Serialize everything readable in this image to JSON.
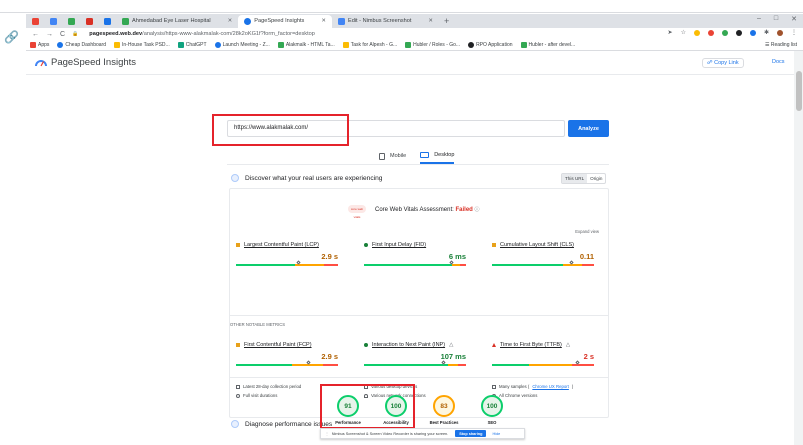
{
  "browser": {
    "tabs": [
      {
        "label": "Ahmedabad Eye Laser Hospital",
        "active": false
      },
      {
        "label": "PageSpeed Insights",
        "active": true
      },
      {
        "label": "Edit - Nimbus Screenshot",
        "active": false
      }
    ],
    "new_tab": "+",
    "window_controls": [
      "–",
      "□",
      "✕"
    ],
    "nav": {
      "back": "←",
      "forward": "→",
      "reload": "C"
    },
    "url_host": "pagespeed.web.dev",
    "url_path": "/analysis/https-www-alakmalak-com/28k2oKG1f?form_factor=desktop",
    "bookmarks": [
      {
        "label": "Apps",
        "color": "#ea4335"
      },
      {
        "label": "Cheap Dashboard",
        "color": "#1a73e8"
      },
      {
        "label": "In-House Task PSD...",
        "color": "#fbbc04"
      },
      {
        "label": "ChatGPT",
        "color": "#10a37f"
      },
      {
        "label": "Launch Meeting - Z...",
        "color": "#1a73e8"
      },
      {
        "label": "Alakmalk - HTML Ta...",
        "color": "#34a853"
      },
      {
        "label": "Task for Alpesh - G...",
        "color": "#fbbc04"
      },
      {
        "label": "Hubler / Roles - Go...",
        "color": "#34a853"
      },
      {
        "label": "RPO Application",
        "color": "#202124"
      },
      {
        "label": "Hubler - after devel...",
        "color": "#34a853"
      }
    ],
    "reading_list": "Reading list"
  },
  "psi": {
    "title": "PageSpeed Insights",
    "copy_link": "Copy Link",
    "docs": "Docs",
    "url_value": "https://www.alakmalak.com/",
    "analyze": "Analyze",
    "device_tabs": {
      "mobile": "Mobile",
      "desktop": "Desktop"
    },
    "crux_heading": "Discover what your real users are experiencing",
    "this_url": "This URL",
    "origin": "Origin",
    "cwv_logo": "core web vitals",
    "cwv_assessment_label": "Core Web Vitals Assessment:",
    "cwv_assessment_status": "Failed",
    "expand_view": "Expand view",
    "other_metrics_label": "OTHER NOTABLE METRICS",
    "metrics": [
      {
        "name": "Largest Contentful Paint (LCP)",
        "value": "2.9 s"
      },
      {
        "name": "First Input Delay (FID)",
        "value": "6 ms"
      },
      {
        "name": "Cumulative Layout Shift (CLS)",
        "value": "0.11"
      },
      {
        "name": "First Contentful Paint (FCP)",
        "value": "2.9 s"
      },
      {
        "name": "Interaction to Next Paint (INP)",
        "value": "107 ms"
      },
      {
        "name": "Time to First Byte (TTFB)",
        "value": "2 s"
      }
    ],
    "info": {
      "period": "Latest 28-day collection period",
      "visit": "Full visit durations",
      "devices": "Various desktop devices",
      "network": "Various network connections",
      "samples_prefix": "Many samples (",
      "samples_link": "Chrome UX Report",
      "samples_suffix": ")",
      "versions": "All Chrome versions"
    },
    "diagnose_heading": "Diagnose performance issues",
    "scores": [
      {
        "label": "Performance",
        "score": "91"
      },
      {
        "label": "Accessibility",
        "score": "100"
      },
      {
        "label": "Best Practices",
        "score": "83"
      },
      {
        "label": "SEO",
        "score": "100"
      }
    ]
  },
  "notification": {
    "text": "Nimbus Screenshot & Screen Video Recorder is sharing your screen.",
    "stop": "Stop sharing",
    "hide": "Hide"
  },
  "colors": {
    "accent": "#1a73e8",
    "pass": "#0cce6b",
    "average": "#ffa400",
    "fail": "#ff4e42",
    "highlight": "#e5232b"
  }
}
